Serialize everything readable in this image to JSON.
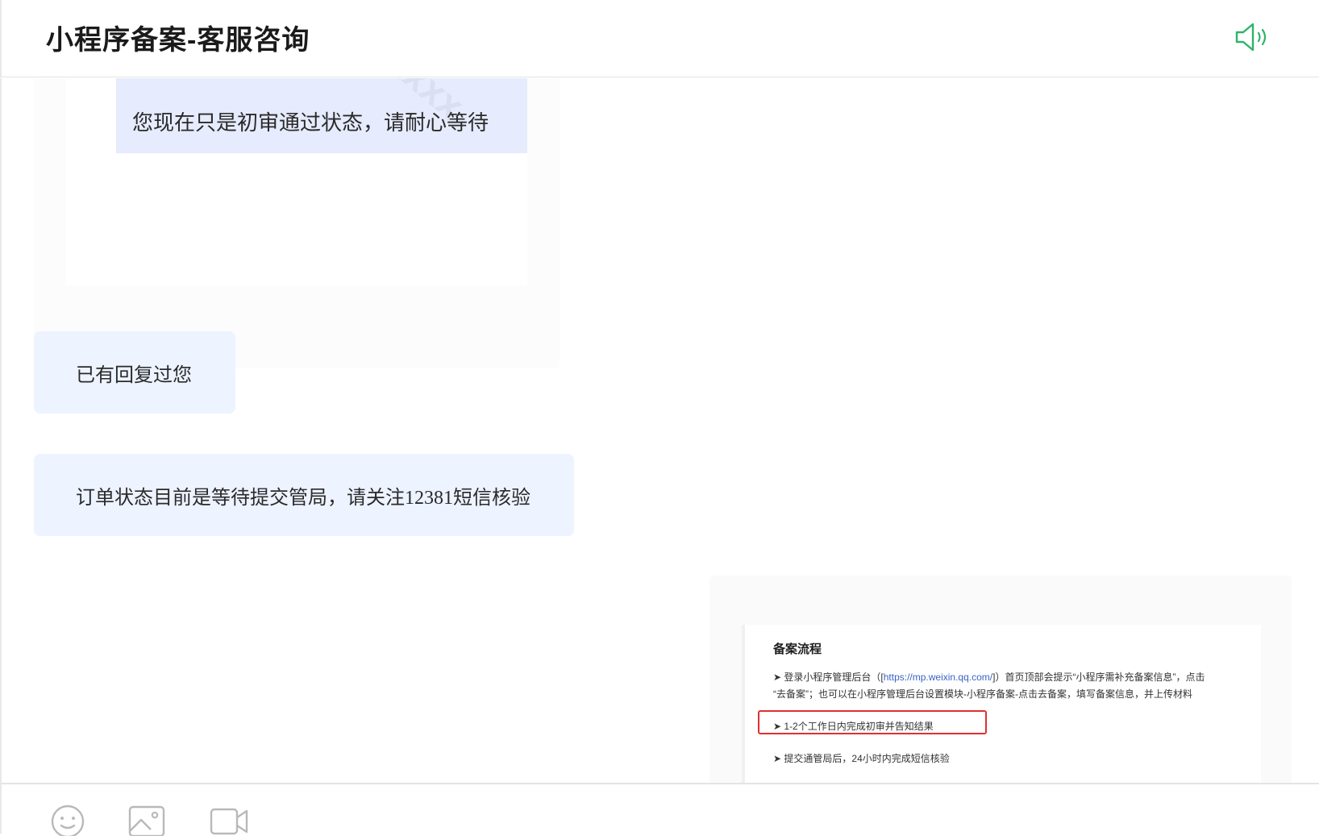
{
  "header": {
    "title": "小程序备案-客服咨询",
    "speaker_icon": "speaker-icon"
  },
  "messages": {
    "image_card": {
      "quote_text": "您现在只是初审通过状态，请耐心等待",
      "watermark": "xxxx"
    },
    "bubble_1": "已有回复过您",
    "bubble_2": "订单状态目前是等待提交管局，请关注12381短信核验",
    "screenshot": {
      "title": "备案流程",
      "line1_pre": "➤ 登录小程序管理后台（[",
      "line1_link": "https://mp.weixin.qq.com/",
      "line1_post": "]）首页顶部会提示“小程序需补充备案信息”，点击",
      "line2": "“去备案”；也可以在小程序管理后台设置模块-小程序备案-点击去备案，填写备案信息，并上传材料",
      "line3": "➤ 1-2个工作日内完成初审并告知结果",
      "line4": "➤ 提交通管局后，24小时内完成短信核验"
    }
  },
  "toolbar": {
    "icons": [
      "emoji-icon",
      "image-icon",
      "video-icon"
    ]
  },
  "colors": {
    "bubble_bg": "#edf3ff",
    "accent_green": "#2fb36a",
    "highlight_red": "#e0302f",
    "link_blue": "#3b63c4"
  }
}
